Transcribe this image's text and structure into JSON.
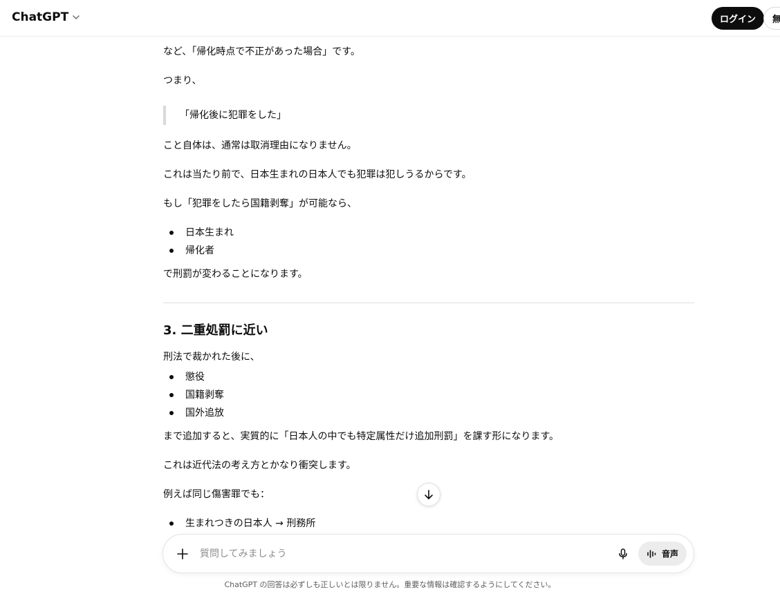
{
  "header": {
    "brand": "ChatGPT",
    "login_label": "ログイン",
    "free_label": "無"
  },
  "message": {
    "p1": "など、「帰化時点で不正があった場合」です。",
    "p2": "つまり、",
    "quote": "「帰化後に犯罪をした」",
    "p3": "こと自体は、通常は取消理由になりません。",
    "p4": "これは当たり前で、日本生まれの日本人でも犯罪は犯しうるからです。",
    "p5": "もし「犯罪をしたら国籍剥奪」が可能なら、",
    "list1": [
      "日本生まれ",
      "帰化者"
    ],
    "p6": "で刑罰が変わることになります。",
    "heading3": "3. 二重処罰に近い",
    "p7": "刑法で裁かれた後に、",
    "list2": [
      "懲役",
      "国籍剥奪",
      "国外追放"
    ],
    "p8": "まで追加すると、実質的に「日本人の中でも特定属性だけ追加刑罰」を課す形になります。",
    "p9": "これは近代法の考え方とかなり衝突します。",
    "p10": "例えば同じ傷害罪でも：",
    "list3": [
      "生まれつきの日本人 → 刑務所"
    ]
  },
  "composer": {
    "placeholder": "質問してみましょう",
    "voice_label": "音声"
  },
  "footer": {
    "disclaimer": "ChatGPT の回答は必ずしも正しいとは限りません。重要な情報は確認するようにしてください。"
  }
}
